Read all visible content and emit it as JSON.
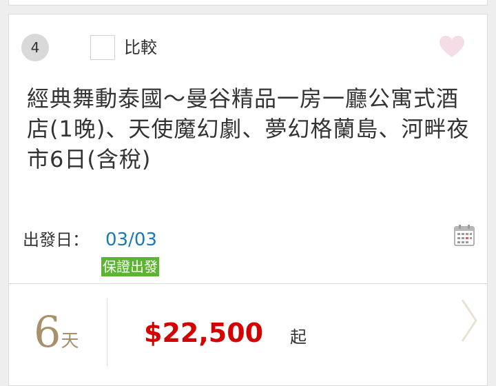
{
  "listing": {
    "rank": "4",
    "compare_label": "比較",
    "title": "經典舞動泰國～曼谷精品一房一廳公寓式酒店(1晚)、天使魔幻劇、夢幻格蘭島、河畔夜市6日(含稅)",
    "departure_label": "出發日：",
    "departure_date": "03/03",
    "guarantee_badge": "保證出發",
    "days_number": "6",
    "days_unit": "天",
    "price": "$22,500",
    "price_suffix": "起"
  },
  "colors": {
    "price": "#d40000",
    "date_link": "#1a79b8",
    "guarantee_badge": "#5cb531",
    "days": "#a8916a",
    "heart": "#f6dce6"
  },
  "icons": {
    "favorite": "heart-icon",
    "calendar": "calendar-icon",
    "next": "chevron-right-icon"
  }
}
